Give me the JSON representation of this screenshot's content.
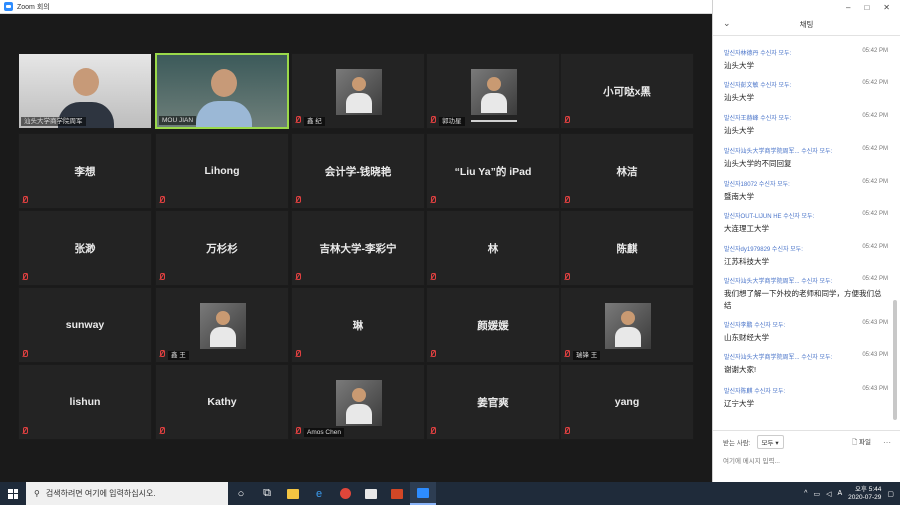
{
  "window": {
    "title": "Zoom 회의"
  },
  "chat": {
    "window_controls": [
      "–",
      "□",
      "✕"
    ],
    "title": "채팅",
    "messages": [
      {
        "from": "발신자林德丹 수신자 모두:",
        "time": "05:42 PM",
        "text": "汕头大学"
      },
      {
        "from": "발신자彭文敏 수신자 모두:",
        "time": "05:42 PM",
        "text": "汕头大学"
      },
      {
        "from": "발신자王赫峰 수신자 모두:",
        "time": "05:42 PM",
        "text": "汕头大学"
      },
      {
        "from": "발신자汕头大学商学院周军... 수신자 모두:",
        "time": "05:42 PM",
        "text": "汕头大学的不同回复"
      },
      {
        "from": "발신자18072 수신자 모두:",
        "time": "05:42 PM",
        "text": "暨南大学"
      },
      {
        "from": "발신자OUT-LIJUN HE 수신자 모두:",
        "time": "05:42 PM",
        "text": "大连理工大学"
      },
      {
        "from": "발신자dy1979829 수신자 모두:",
        "time": "05:42 PM",
        "text": "江苏科技大学"
      },
      {
        "from": "발신자汕头大学商学院周军... 수신자 모두:",
        "time": "05:42 PM",
        "text": "我们想了解一下外校的老师和同学，方便我们总结"
      },
      {
        "from": "발신자李鹏 수신자 모두:",
        "time": "05:43 PM",
        "text": "山东财经大学"
      },
      {
        "from": "발신자汕头大学商学院周军... 수신자 모두:",
        "time": "05:43 PM",
        "text": "谢谢大家!"
      },
      {
        "from": "발신자陈麒 수신자 모두:",
        "time": "05:43 PM",
        "text": "辽宁大学"
      }
    ],
    "send_to_label": "받는 사람:",
    "send_to_value": "모두",
    "file_label": "파일",
    "input_placeholder": "여기에 메시지 입력..."
  },
  "participants": [
    {
      "name": "汕头大学商学院周军",
      "video": true,
      "row": 0,
      "col": 0
    },
    {
      "name": "MOU JIAN",
      "video": true,
      "active": true,
      "row": 0,
      "col": 1
    },
    {
      "name": "鑫 纪",
      "thumb": true,
      "row": 0,
      "col": 2
    },
    {
      "name": "郭功星",
      "thumb": true,
      "row": 0,
      "col": 3,
      "speaking": true
    },
    {
      "name": "小可哒x黑",
      "row": 0,
      "col": 4
    },
    {
      "name": "李想",
      "row": 1,
      "col": 0
    },
    {
      "name": "Lihong",
      "row": 1,
      "col": 1
    },
    {
      "name": "会计学-钱晓艳",
      "row": 1,
      "col": 2
    },
    {
      "name": "“Liu Ya”的 iPad",
      "row": 1,
      "col": 3
    },
    {
      "name": "林洁",
      "row": 1,
      "col": 4
    },
    {
      "name": "张渺",
      "row": 2,
      "col": 0
    },
    {
      "name": "万杉杉",
      "row": 2,
      "col": 1
    },
    {
      "name": "吉林大学-李彩宁",
      "row": 2,
      "col": 2
    },
    {
      "name": "林",
      "row": 2,
      "col": 3
    },
    {
      "name": "陈麒",
      "row": 2,
      "col": 4
    },
    {
      "name": "sunway",
      "row": 3,
      "col": 0
    },
    {
      "name": "鑫 王",
      "thumb": true,
      "row": 3,
      "col": 1
    },
    {
      "name": "琳",
      "row": 3,
      "col": 2
    },
    {
      "name": "颜媛媛",
      "row": 3,
      "col": 3
    },
    {
      "name": "瑞锋 王",
      "thumb": true,
      "row": 3,
      "col": 4
    },
    {
      "name": "lishun",
      "row": 4,
      "col": 0
    },
    {
      "name": "Kathy",
      "row": 4,
      "col": 1
    },
    {
      "name": "Amos Chen",
      "thumb": true,
      "row": 4,
      "col": 2
    },
    {
      "name": "姜官爽",
      "row": 4,
      "col": 3
    },
    {
      "name": "yang",
      "row": 4,
      "col": 4
    }
  ],
  "taskbar": {
    "search_placeholder": "검색하려면 여기에 입력하십시오.",
    "tray_lang": "A",
    "time": "오후 5:44",
    "date": "2020-07-29"
  }
}
